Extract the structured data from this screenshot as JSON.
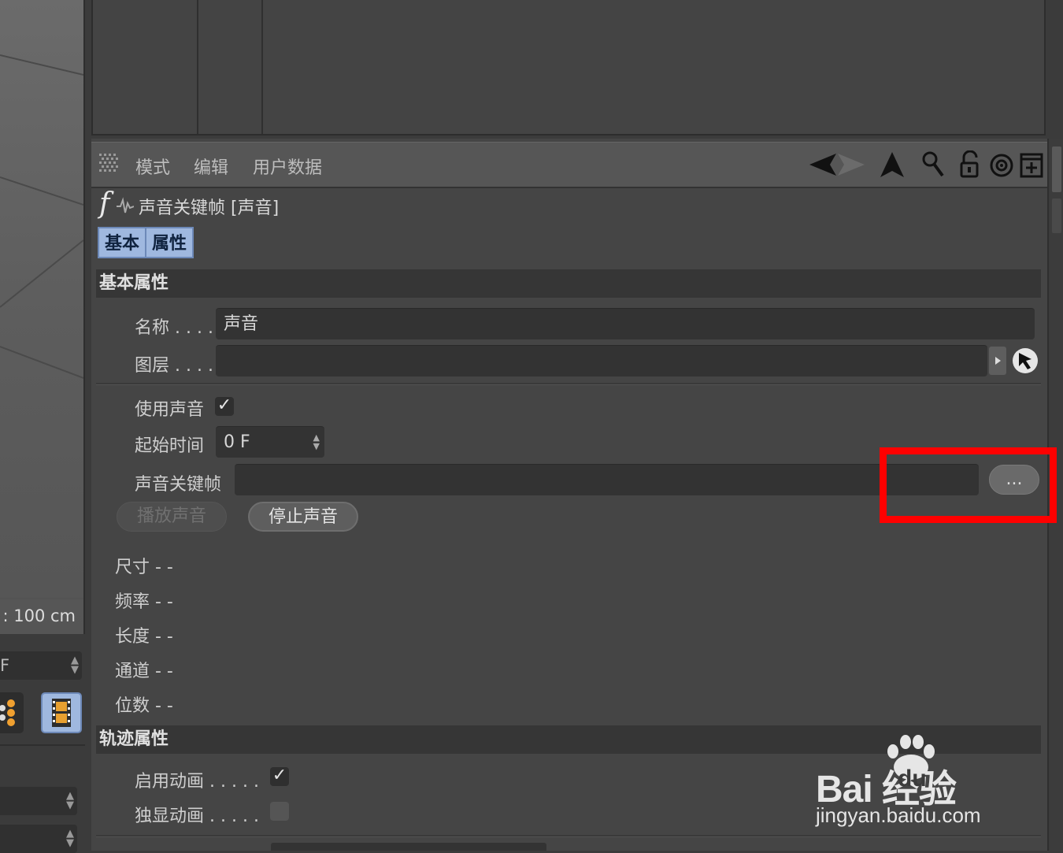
{
  "viewport": {
    "scale_text": ": 100 cm"
  },
  "left_strip": {
    "frame_field": "F"
  },
  "menubar": {
    "items": [
      "模式",
      "编辑",
      "用户数据"
    ]
  },
  "object": {
    "title": "声音关键帧 [声音]",
    "fx_glyph": "f"
  },
  "tabs": [
    "基本",
    "属性"
  ],
  "basic_section": {
    "title": "基本属性",
    "name_label": "名称 . . . .",
    "name_value": "声音",
    "layer_label": "图层 . . . .",
    "layer_value": ""
  },
  "sound": {
    "use_sound_label": "使用声音",
    "use_sound_checked": true,
    "start_time_label": "起始时间",
    "start_time_value": "0 F",
    "keyframe_label": "声音关键帧",
    "keyframe_value": "",
    "browse_label": "...",
    "play_label": "播放声音",
    "stop_label": "停止声音",
    "info": [
      "尺寸 - -",
      "频率 - -",
      "长度 - -",
      "通道 - -",
      "位数 - -"
    ]
  },
  "track_section": {
    "title": "轨迹属性",
    "enable_anim_label": "启用动画 . . . . .",
    "enable_anim_checked": true,
    "solo_anim_label": "独显动画 . . . . .",
    "solo_anim_checked": false
  },
  "watermark": {
    "brand": "Bai  经验",
    "brand_du": "du",
    "url": "jingyan.baidu.com"
  },
  "colors": {
    "highlight": "#ff0000",
    "tab_active": "#9fb8df"
  }
}
